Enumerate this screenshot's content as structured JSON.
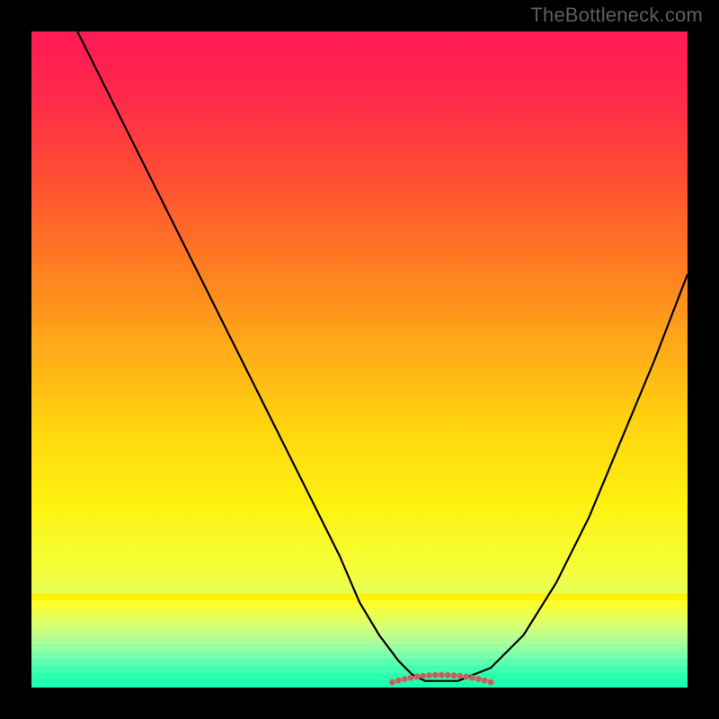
{
  "watermark": "TheBottleneck.com",
  "colors": {
    "black": "#000000",
    "curve": "#000000",
    "dots": "#c9605d",
    "watermark": "#5e5e5e"
  },
  "gradient_stops": [
    {
      "offset": 0.0,
      "color": "#ff1a55"
    },
    {
      "offset": 0.1,
      "color": "#ff2a4a"
    },
    {
      "offset": 0.22,
      "color": "#ff4d33"
    },
    {
      "offset": 0.35,
      "color": "#ff7a22"
    },
    {
      "offset": 0.48,
      "color": "#ffaa18"
    },
    {
      "offset": 0.6,
      "color": "#ffd40f"
    },
    {
      "offset": 0.72,
      "color": "#fff210"
    },
    {
      "offset": 0.82,
      "color": "#f4ff3a"
    },
    {
      "offset": 0.88,
      "color": "#deff6a"
    },
    {
      "offset": 0.92,
      "color": "#b6ff8c"
    },
    {
      "offset": 0.95,
      "color": "#86ffa0"
    },
    {
      "offset": 0.975,
      "color": "#4fffb0"
    },
    {
      "offset": 1.0,
      "color": "#1cffb0"
    }
  ],
  "bottom_stripes": [
    "#fff210",
    "#fbff2a",
    "#f0ff45",
    "#e4ff5c",
    "#d6ff72",
    "#c4ff86",
    "#afff97",
    "#96ffa4",
    "#7affad",
    "#5cffb0",
    "#40ffb0",
    "#2affb0",
    "#1cffb0"
  ],
  "chart_data": {
    "type": "line",
    "title": "",
    "xlabel": "",
    "ylabel": "",
    "xlim": [
      0,
      100
    ],
    "ylim": [
      0,
      100
    ],
    "series": [
      {
        "name": "bottleneck-curve",
        "x": [
          7,
          12,
          17,
          22,
          27,
          32,
          37,
          42,
          47,
          50,
          53,
          56,
          58,
          60,
          65,
          70,
          75,
          80,
          85,
          90,
          95,
          100
        ],
        "y": [
          100,
          90,
          80,
          70,
          60,
          50,
          40,
          30,
          20,
          13,
          8,
          4,
          2,
          1,
          1,
          3,
          8,
          16,
          26,
          38,
          50,
          63
        ]
      }
    ],
    "flat_region": {
      "x_start": 55,
      "x_end": 70,
      "y": 1.5
    },
    "annotations": [
      {
        "text": "TheBottleneck.com",
        "role": "watermark",
        "position": "top-right"
      }
    ]
  }
}
